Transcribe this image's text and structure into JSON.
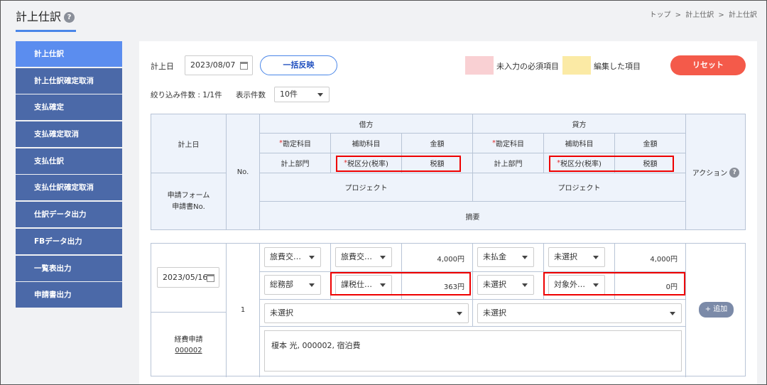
{
  "header": {
    "title": "計上仕訳",
    "help": "?",
    "breadcrumb": [
      "トップ",
      ">",
      "計上仕訳",
      ">",
      "計上仕訳"
    ]
  },
  "sidebar": {
    "items": [
      {
        "label": "計上仕訳",
        "active": true
      },
      {
        "label": "計上仕訳確定取消"
      },
      {
        "label": "支払確定"
      },
      {
        "label": "支払確定取消"
      },
      {
        "label": "支払仕訳"
      },
      {
        "label": "支払仕訳確定取消"
      },
      {
        "label": "仕訳データ出力"
      },
      {
        "label": "FBデータ出力"
      },
      {
        "label": "一覧表出力"
      },
      {
        "label": "申請書出力"
      }
    ]
  },
  "filters": {
    "date_label": "計上日",
    "date_value": "2023/08/07",
    "bulk_button": "一括反映",
    "legend_required": "未入力の必須項目",
    "legend_edited": "編集した項目",
    "reset_button": "リセット",
    "count_text": "絞り込み件数 : 1/1件",
    "per_page_label": "表示件数",
    "per_page_value": "10件"
  },
  "colors": {
    "required_swatch": "#f9d0d3",
    "edited_swatch": "#fbeaa5",
    "accent": "#4a86e8",
    "reset": "#f45a4a"
  },
  "table_header": {
    "posting_date": "計上日",
    "form_label": "申請フォーム",
    "form_no": "申請書No.",
    "no": "No.",
    "debit": "借方",
    "credit": "貸方",
    "req_mark": "*",
    "account": "勘定科目",
    "sub_account": "補助科目",
    "amount": "金額",
    "department": "計上部門",
    "tax_class": "税区分(税率)",
    "tax_amount": "税額",
    "project": "プロジェクト",
    "summary": "摘要",
    "action": "アクション"
  },
  "row": {
    "date": "2023/05/16",
    "no": "1",
    "form_name": "経費申請",
    "form_number": "000002",
    "debit_account": "旅費交…",
    "debit_sub": "旅費交…",
    "debit_amount": "4,000円",
    "debit_dept": "総務部",
    "debit_tax_class": "課税仕…",
    "debit_tax": "363円",
    "debit_project": "未選択",
    "credit_account": "未払金",
    "credit_sub": "未選択",
    "credit_amount": "4,000円",
    "credit_dept": "未選択",
    "credit_tax_class": "対象外…",
    "credit_tax": "0円",
    "credit_project": "未選択",
    "summary": "榎本 光, 000002, 宿泊費",
    "add_button": "+ 追加"
  }
}
